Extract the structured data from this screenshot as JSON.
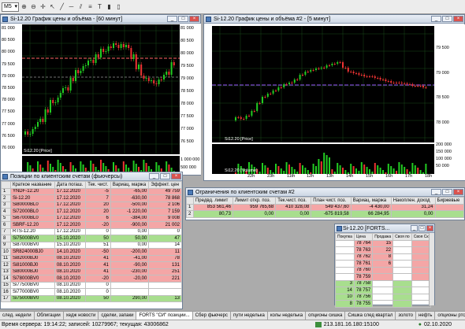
{
  "toolbar": {
    "timeframe": "M5"
  },
  "chart1": {
    "title": "Si-12.20 График цены и объёма - [60 минут]",
    "legend": "Si12.20 [Price]",
    "price_axis": [
      "81 000",
      "80 500",
      "80 000",
      "79 500",
      "79 000",
      "78 500",
      "78 000",
      "77 500",
      "77 000",
      "76 500",
      "76 000"
    ],
    "right_labels": [
      "81 000",
      "80 500",
      "80 000",
      "79 500",
      "79 000",
      "78 500",
      "78 000",
      "77 500",
      "77 000",
      "76 500"
    ],
    "volume_axis": [
      "1 000 000",
      "500 000"
    ],
    "colors": {
      "up": "#22cc22",
      "down": "#ee3333",
      "bg": "#000000"
    }
  },
  "chart2": {
    "title": "Si-12.20 График цены и объёма #2 - [5 минут]",
    "legend": "Si12.20 [Price]",
    "volume_legend": "Si12.20 [Volume]",
    "price_axis": [
      "79 500",
      "79 000",
      "78 500",
      "78 000"
    ],
    "volume_axis": [
      "200 000",
      "150 000",
      "100 000",
      "50 000"
    ],
    "time_axis": [
      "22h",
      "23h",
      "11th",
      "12h",
      "13h",
      "14h",
      "15h",
      "16h",
      "17h",
      "18h"
    ]
  },
  "positions": {
    "title": "Позиции по клиентским счетам (фьючерсы)",
    "headers": [
      "Краткое название",
      "Дата погаш.",
      "Тек. чист.",
      "Вариац. маржа",
      "Эффект. цен"
    ],
    "rows": [
      {
        "n": "1",
        "name": "YNDF-12.20",
        "date": "17.12.2020",
        "pos": "-5",
        "var": "-65,00",
        "eff": "49 759",
        "style": "red"
      },
      {
        "n": "2",
        "name": "Si-12.20",
        "date": "17.12.2020",
        "pos": "7",
        "var": "-630,00",
        "eff": "78 868",
        "style": "red"
      },
      {
        "n": "3",
        "name": "Si80000BL0",
        "date": "17.12.2020",
        "pos": "20",
        "var": "-500,00",
        "eff": "2 106",
        "style": "red"
      },
      {
        "n": "4",
        "name": "Si72000BL0",
        "date": "17.12.2020",
        "pos": "20",
        "var": "-1 220,00",
        "eff": "7 159",
        "style": "red"
      },
      {
        "n": "5",
        "name": "Si67000BL0",
        "date": "17.12.2020",
        "pos": "6",
        "var": "-384,00",
        "eff": "9 008",
        "style": "red"
      },
      {
        "n": "6",
        "name": "SBRF-12.20",
        "date": "17.12.2020",
        "pos": "-20",
        "var": "-900,00",
        "eff": "21 002",
        "style": "red"
      },
      {
        "n": "7",
        "name": "RTS-12.20",
        "date": "17.12.2020",
        "pos": "0",
        "var": "0,00",
        "eff": "0",
        "style": ""
      },
      {
        "n": "8",
        "name": "Si75000BV0",
        "date": "15.10.2020",
        "pos": "50",
        "var": "50,00",
        "eff": "47",
        "style": "green"
      },
      {
        "n": "9",
        "name": "Si87000BV0",
        "date": "15.10.2020",
        "pos": "51",
        "var": "0,00",
        "eff": "14",
        "style": ""
      },
      {
        "n": "10",
        "name": "SR824000BJ0",
        "date": "14.10.2020",
        "pos": "-50",
        "var": "-200,00",
        "eff": "11",
        "style": "red"
      },
      {
        "n": "11",
        "name": "Si82000BJ0",
        "date": "08.10.2020",
        "pos": "41",
        "var": "-41,00",
        "eff": "78",
        "style": "red"
      },
      {
        "n": "12",
        "name": "Si81000BJ0",
        "date": "08.10.2020",
        "pos": "41",
        "var": "-90,00",
        "eff": "131",
        "style": "red"
      },
      {
        "n": "13",
        "name": "Si80000BJ0",
        "date": "08.10.2020",
        "pos": "41",
        "var": "-230,00",
        "eff": "251",
        "style": "red"
      },
      {
        "n": "14",
        "name": "Si78000BV0",
        "date": "08.10.2020",
        "pos": "-20",
        "var": "-20,00",
        "eff": "221",
        "style": "red"
      },
      {
        "n": "15",
        "name": "Si77500BV0",
        "date": "08.10.2020",
        "pos": "0",
        "var": "",
        "eff": "",
        "style": ""
      },
      {
        "n": "16",
        "name": "Si77000BV0",
        "date": "08.10.2020",
        "pos": "0",
        "var": "",
        "eff": "",
        "style": ""
      },
      {
        "n": "17",
        "name": "Si75000BV0",
        "date": "08.10.2020",
        "pos": "50",
        "var": "290,00",
        "eff": "13",
        "style": "green"
      }
    ]
  },
  "limits": {
    "title": "Ограничения по клиентским счетам #2",
    "headers": [
      "",
      "Предвд. лимит",
      "Лимит откр. поз.",
      "Тек.чист. поз.",
      "План чист. поз.",
      "Вариац. маржа",
      "Накоплен. доход",
      "Биржевые"
    ],
    "rows": [
      {
        "n": "1",
        "c1": "853 561,46",
        "c2": "959 765,68",
        "c3": "410 328,08",
        "c4": "549 437,60",
        "c5": "-4 430,00",
        "c6": "31,24",
        "c7": "",
        "style": "red"
      },
      {
        "n": "2",
        "c1": "80,73",
        "c2": "0,00",
        "c3": "0,00",
        "c4": "-675 819,58",
        "c5": "66 284,95",
        "c6": "0,00",
        "c7": "",
        "style": "green"
      }
    ]
  },
  "orderbook": {
    "title": "Si-12.20 [FORTS...",
    "headers": [
      "Покупка",
      "Цена",
      "Продажа",
      "Своя по",
      "Своя Ск"
    ],
    "rows": [
      {
        "buy": "",
        "price": "78 764",
        "sell": "15",
        "side": "sell"
      },
      {
        "buy": "",
        "price": "78 763",
        "sell": "22",
        "side": "sell"
      },
      {
        "buy": "",
        "price": "78 762",
        "sell": "8",
        "side": "sell"
      },
      {
        "buy": "",
        "price": "78 761",
        "sell": "6",
        "side": "sell"
      },
      {
        "buy": "",
        "price": "78 760",
        "sell": "",
        "side": "sell"
      },
      {
        "buy": "",
        "price": "78 759",
        "sell": "",
        "side": "sell"
      },
      {
        "buy": "3",
        "price": "78 758",
        "sell": "",
        "side": "buy"
      },
      {
        "buy": "14",
        "price": "78 757",
        "sell": "",
        "side": "buy"
      },
      {
        "buy": "10",
        "price": "78 756",
        "sell": "",
        "side": "buy"
      },
      {
        "buy": "8",
        "price": "78 755",
        "sell": "",
        "side": "buy"
      }
    ]
  },
  "tabs": [
    "след. недели",
    "Облигации",
    "хедж новости",
    "сделки, запаки",
    "FORTS \"СИ\" позиции...",
    "Сбер фьючерс",
    "пути неделька",
    "колы неделька",
    "опционы сишка",
    "Сишка след квартал",
    "золото",
    "нефть",
    "опционы ртс",
    "яндекс"
  ],
  "status": {
    "left": "Время сервера: 19:14:22; записей: 10279967; текущая: 43006862",
    "ip": "213.181.16.180:15100",
    "date": "02.10.2020"
  }
}
